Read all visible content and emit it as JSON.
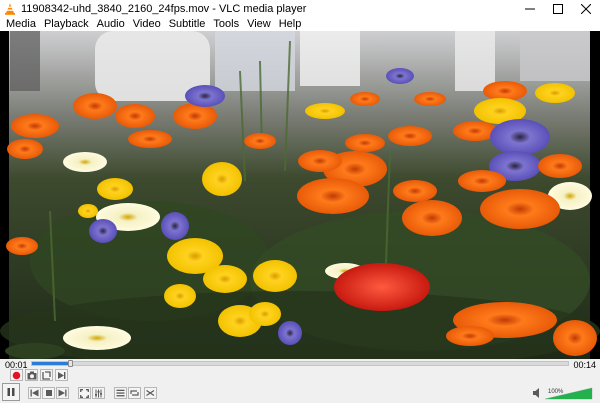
{
  "window": {
    "title": "11908342-uhd_3840_2160_24fps.mov - VLC media player",
    "app_icon": "vlc-cone-icon",
    "controls": [
      "minimize-icon",
      "maximize-icon",
      "close-icon"
    ]
  },
  "menu": {
    "items": [
      {
        "label": "Media"
      },
      {
        "label": "Playback"
      },
      {
        "label": "Audio"
      },
      {
        "label": "Video"
      },
      {
        "label": "Subtitle"
      },
      {
        "label": "Tools"
      },
      {
        "label": "View"
      },
      {
        "label": "Help"
      }
    ]
  },
  "video": {
    "content": "flower-bed-frame"
  },
  "playback": {
    "elapsed": "00:01",
    "total": "00:14",
    "progress": 0.07
  },
  "volume": {
    "label": "100%",
    "level": 1.0
  },
  "colors": {
    "accent": "#2b7cd6",
    "record": "#e81123",
    "volume_green": "#23b14d"
  },
  "buttons": {
    "row1": [
      "record-icon",
      "snapshot-icon",
      "loop-ab-icon",
      "frame-step-icon"
    ],
    "row2": [
      "play-pause-icon",
      "previous-icon",
      "stop-icon",
      "next-icon",
      "fullscreen-icon",
      "extended-settings-icon",
      "playlist-icon",
      "loop-icon",
      "shuffle-icon"
    ]
  }
}
